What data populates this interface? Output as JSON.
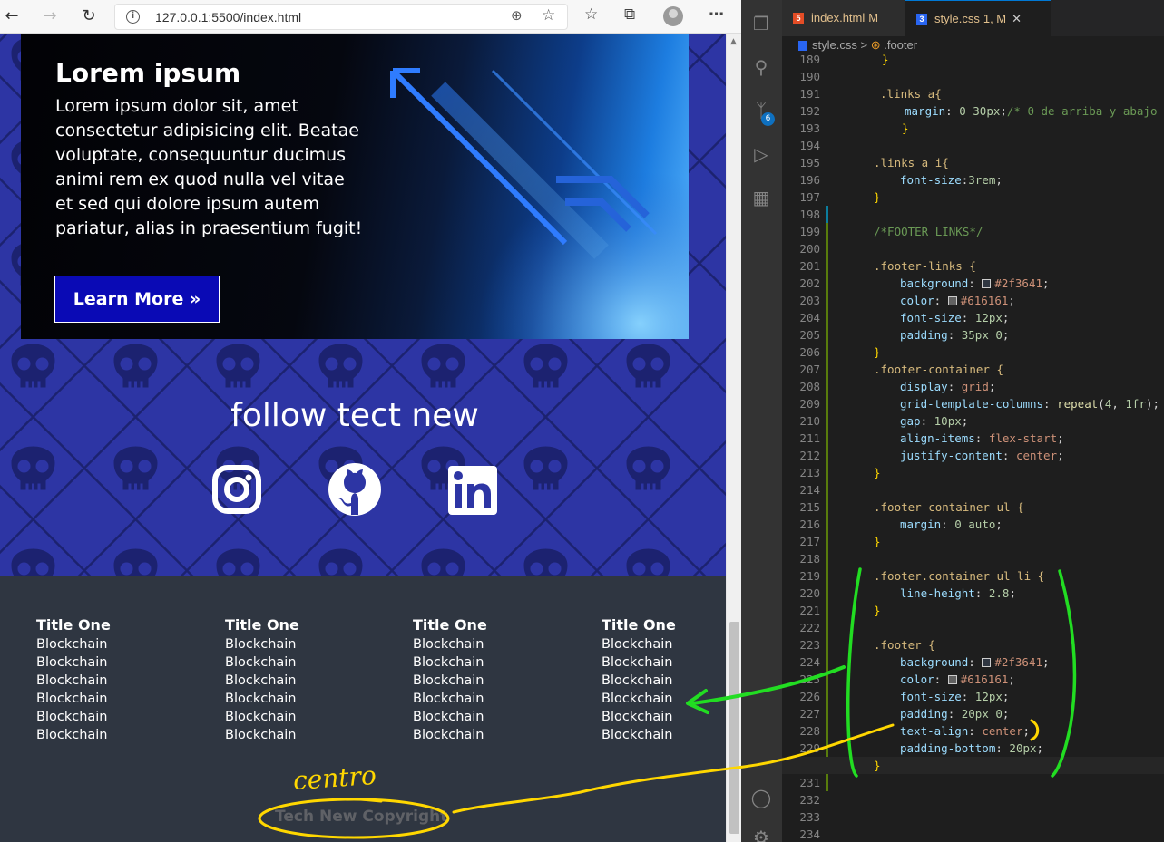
{
  "browser": {
    "url": "127.0.0.1:5500/index.html",
    "icons": {
      "back": "arrow-left",
      "forward": "arrow-right",
      "reload": "reload",
      "info": "info",
      "zoom": "zoom-in",
      "favorite": "star-add",
      "favorites": "star-list",
      "collections": "collections",
      "profile": "avatar",
      "menu": "more"
    }
  },
  "hero": {
    "title": "Lorem ipsum",
    "text": "Lorem ipsum dolor sit, amet consectetur adipisicing elit. Beatae voluptate, consequuntur ducimus animi rem ex quod nulla vel vitae et sed qui dolore ipsum autem pariatur, alias in praesentium fugit!",
    "button": "Learn More »"
  },
  "follow": {
    "title": "follow tect new",
    "icons": [
      "instagram-icon",
      "github-icon",
      "linkedin-icon"
    ]
  },
  "footer": {
    "columns": [
      {
        "title": "Title One",
        "items": [
          "Blockchain",
          "Blockchain",
          "Blockchain",
          "Blockchain",
          "Blockchain",
          "Blockchain"
        ]
      },
      {
        "title": "Title One",
        "items": [
          "Blockchain",
          "Blockchain",
          "Blockchain",
          "Blockchain",
          "Blockchain",
          "Blockchain"
        ]
      },
      {
        "title": "Title One",
        "items": [
          "Blockchain",
          "Blockchain",
          "Blockchain",
          "Blockchain",
          "Blockchain",
          "Blockchain"
        ]
      },
      {
        "title": "Title One",
        "items": [
          "Blockchain",
          "Blockchain",
          "Blockchain",
          "Blockchain",
          "Blockchain",
          "Blockchain"
        ]
      }
    ],
    "copyright": "Tech New Copyright"
  },
  "annotation": {
    "label": "centro"
  },
  "vscode": {
    "tabs": [
      {
        "label": "index.html",
        "badge": "M",
        "file_type": "HTML"
      },
      {
        "label": "style.css",
        "badge": "1, M",
        "file_type": "CSS",
        "active": true
      }
    ],
    "breadcrumb": {
      "file": "style.css",
      "separator": ">",
      "symbol": ".footer"
    },
    "source_control_badge": "6",
    "line_numbers": [
      "189",
      "190",
      "191",
      "192",
      "193",
      "194",
      "195",
      "196",
      "197",
      "198",
      "199",
      "200",
      "201",
      "202",
      "203",
      "204",
      "205",
      "206",
      "207",
      "208",
      "209",
      "210",
      "211",
      "212",
      "213",
      "214",
      "215",
      "216",
      "217",
      "218",
      "219",
      "220",
      "221",
      "222",
      "223",
      "224",
      "225",
      "226",
      "227",
      "228",
      "229",
      "230",
      "231",
      "232",
      "233",
      "234"
    ],
    "active_line": "230",
    "code": {
      "l189": "}",
      "l191_sel": ".links a{",
      "l192_prop": "margin",
      "l192_val": "0 30px",
      "l192_com": "/* 0 de arriba y abajo",
      "l193": "}",
      "l195_sel": ".links a i{",
      "l196_prop": "font-size",
      "l196_val": "3rem",
      "l197": "}",
      "l199_com": "/*FOOTER LINKS*/",
      "l201_sel": ".footer-links {",
      "l202_prop": "background",
      "l202_val": "#2f3641",
      "l203_prop": "color",
      "l203_val": "#616161",
      "l204_prop": "font-size",
      "l204_val": "12px",
      "l205_prop": "padding",
      "l205_val": "35px 0",
      "l206": "}",
      "l207_sel": ".footer-container {",
      "l208_prop": "display",
      "l208_val": "grid",
      "l209_prop": "grid-template-columns",
      "l209_fn": "repeat",
      "l209_num": "4",
      "l209_val": "1fr",
      "l210_prop": "gap",
      "l210_val": "10px",
      "l211_prop": "align-items",
      "l211_val": "flex-start",
      "l212_prop": "justify-content",
      "l212_val": "center",
      "l213": "}",
      "l215_sel": ".footer-container ul {",
      "l216_prop": "margin",
      "l216_val": "0 auto",
      "l217": "}",
      "l219_sel": ".footer.container ul li {",
      "l220_prop": "line-height",
      "l220_val": "2.8",
      "l221": "}",
      "l223_sel": ".footer {",
      "l224_prop": "background",
      "l224_val": "#2f3641",
      "l225_prop": "color",
      "l225_val": "#616161",
      "l226_prop": "font-size",
      "l226_val": "12px",
      "l227_prop": "padding",
      "l227_val": "20px 0",
      "l228_prop": "text-align",
      "l228_val": "center",
      "l229_prop": "padding-bottom",
      "l229_val": "20px",
      "l230": "}"
    }
  },
  "colors": {
    "page_bg": "#2d35a4",
    "footer_bg": "#2f3641",
    "button_bg": "#0a0ab5",
    "annotation_green": "#22dd22",
    "annotation_yellow": "#ffd700"
  }
}
